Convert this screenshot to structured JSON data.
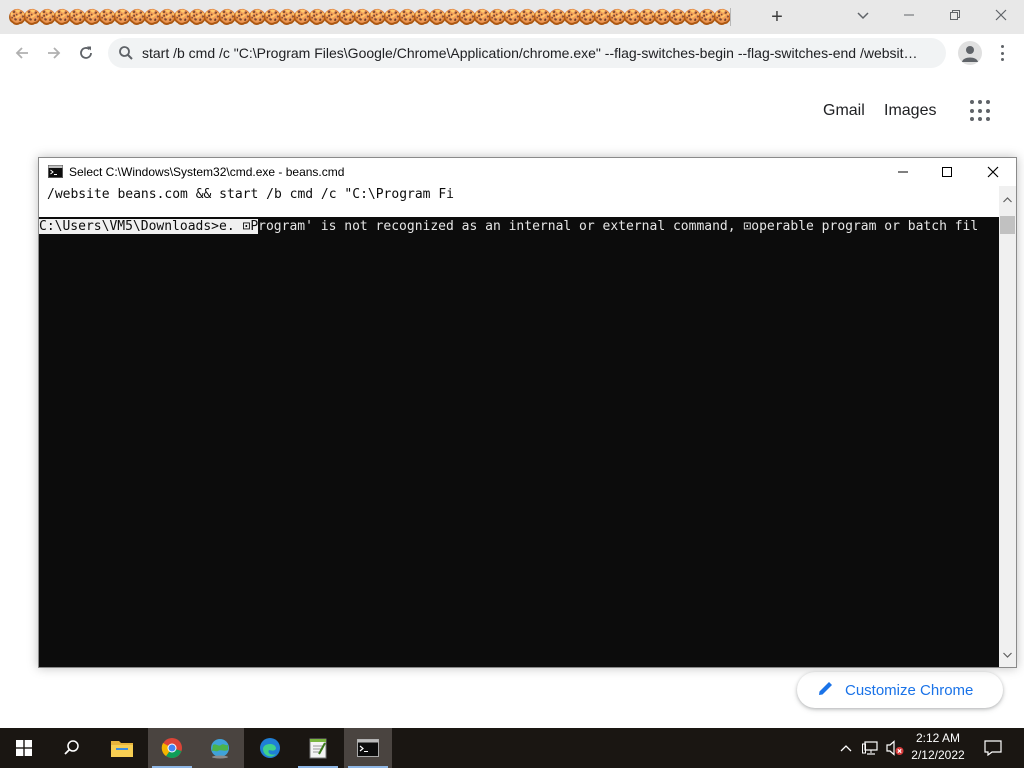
{
  "browser": {
    "tabs_glyphs": [
      "🍪",
      "🍪",
      "🍪",
      "🍪",
      "🍪",
      "🍪",
      "🍪",
      "🍪",
      "🍪",
      "🍪",
      "🍪",
      "🍪",
      "🍪",
      "🍪",
      "🍪",
      "🍪",
      "🍪",
      "🍪",
      "🍪",
      "🍪",
      "🍪",
      "🍪",
      "🍪",
      "🍪",
      "🍪",
      "🍪",
      "🍪",
      "🍪",
      "🍪",
      "🍪",
      "🍪",
      "🍪",
      "🍪",
      "🍪",
      "🍪",
      "🍪",
      "🍪",
      "🍪",
      "🍪",
      "🍪",
      "🍪",
      "🍪",
      "🍪",
      "🍪",
      "🍪",
      "🍪",
      "🍪",
      "🍪"
    ],
    "new_tab_label": "+",
    "omnibox_text": "start /b cmd /c \"C:\\Program Files\\Google/Chrome\\Application/chrome.exe\" --flag-switches-begin --flag-switches-end /websit…"
  },
  "ntp": {
    "gmail_label": "Gmail",
    "images_label": "Images",
    "customize_label": "Customize Chrome"
  },
  "cmd": {
    "title": "Select C:\\Windows\\System32\\cmd.exe - beans.cmd",
    "line1": "/website beans.com && start /b cmd /c \"C:\\Program Fi",
    "prompt_selected": "C:\\Users\\VM5\\Downloads>e. ⊡P",
    "prompt_rest": "rogram' is not recognized as an internal or external command, ⊡operable program or batch fil"
  },
  "taskbar": {
    "time": "2:12 AM",
    "date": "2/12/2022",
    "accent_color": "#8fb7e6"
  },
  "icons": [
    "window-close-icon",
    "minimize-icon",
    "maximize-icon",
    "restore-icon",
    "chevron-down-icon",
    "back-arrow-icon",
    "forward-arrow-icon",
    "reload-icon",
    "search-icon",
    "profile-icon",
    "kebab-menu-icon",
    "apps-grid-icon",
    "pencil-icon",
    "windows-start-icon",
    "search-taskbar-icon",
    "file-explorer-icon",
    "chrome-icon",
    "network-globe-icon",
    "edge-icon",
    "notepad-icon",
    "cmd-icon",
    "chevron-up-icon",
    "network-tray-icon",
    "volume-muted-icon",
    "notification-icon"
  ]
}
